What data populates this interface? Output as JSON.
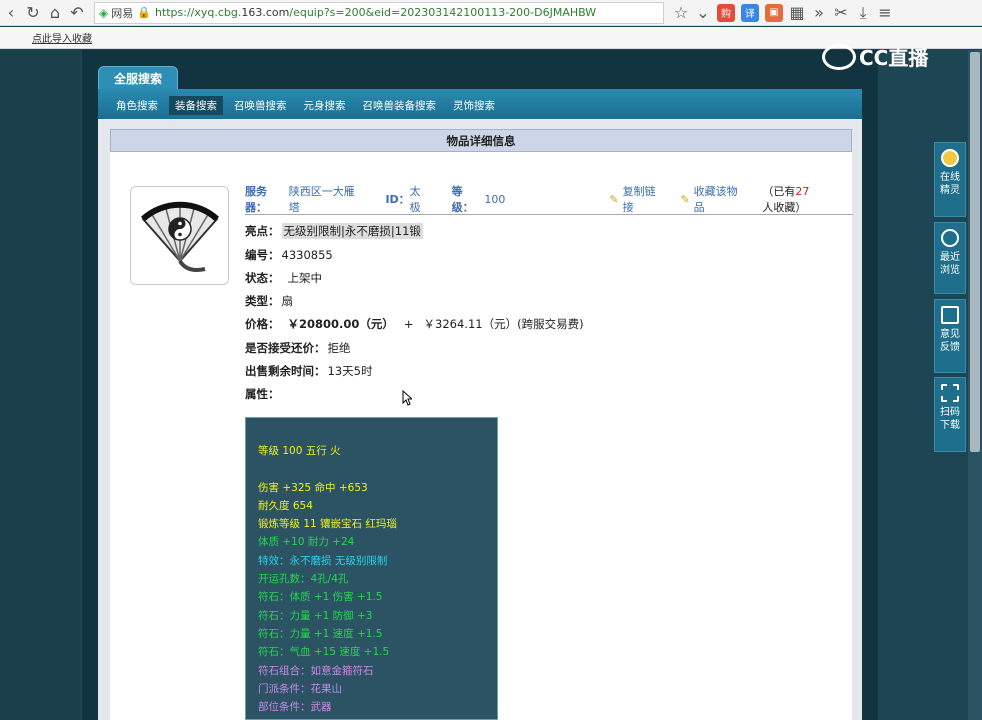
{
  "browser": {
    "url_prefix": "https://xyq.cbg.",
    "url_domain": "163.com",
    "url_path": "/equip?s=200&eid=202303142100113-200-D6JMAHBW",
    "site_label": "网易",
    "bookmark": "点此导入收藏"
  },
  "logo": "CC直播",
  "main_tab": "全服搜索",
  "nav": [
    "角色搜索",
    "装备搜索",
    "召唤兽搜索",
    "元身搜索",
    "召唤兽装备搜索",
    "灵饰搜索"
  ],
  "detail_header": "物品详细信息",
  "seller": {
    "server_label": "服务器：",
    "server_value": "陕西区一大雁塔",
    "id_label": "ID：",
    "id_value": "太极",
    "level_label": "等级：",
    "level_value": "100",
    "copy_link": "复制链接",
    "favorite": "收藏该物品",
    "fav_prefix": "（已有",
    "fav_count": "27",
    "fav_suffix": "人收藏）"
  },
  "fields": {
    "highlight_label": "亮点：",
    "highlight_value": "无级别限制|永不磨损|11锻",
    "id_label": "编号：",
    "id_value": "4330855",
    "status_label": "状态：",
    "status_value": "上架中",
    "type_label": "类型：",
    "type_value": "扇",
    "price_label": "价格：",
    "price_value": "￥20800.00（元）",
    "price_plus": "+",
    "price_fee": "￥3264.11（元）(跨服交易费)",
    "bargain_label": "是否接受还价：",
    "bargain_value": "拒绝",
    "time_label": "出售剩余时间：",
    "time_value": "13天5时",
    "attr_label": "属性："
  },
  "attributes": [
    {
      "text": "等级 100 五行 火",
      "color": "yellow"
    },
    {
      "text": "",
      "color": "yellow"
    },
    {
      "text": "伤害 +325 命中 +653",
      "color": "yellow"
    },
    {
      "text": "耐久度 654",
      "color": "yellow"
    },
    {
      "text": "锻炼等级 11 镶嵌宝石 红玛瑙",
      "color": "yellow"
    },
    {
      "text": "体质 +10 耐力 +24",
      "color": "green"
    },
    {
      "text": "特效：永不磨损 无级别限制",
      "color": "cyan"
    },
    {
      "text": "开运孔数：4孔/4孔",
      "color": "green"
    },
    {
      "text": "符石：体质 +1 伤害 +1.5",
      "color": "green"
    },
    {
      "text": "符石：力量 +1 防御 +3",
      "color": "green"
    },
    {
      "text": "符石：力量 +1 速度 +1.5",
      "color": "green"
    },
    {
      "text": "符石：气血 +15 速度 +1.5",
      "color": "green"
    },
    {
      "text": "符石组合：如意金箍符石",
      "color": "purple"
    },
    {
      "text": "门派条件：花果山",
      "color": "purple"
    },
    {
      "text": "部位条件：武器",
      "color": "purple"
    }
  ],
  "side_panel": [
    {
      "line1": "在线",
      "line2": "精灵"
    },
    {
      "line1": "最近",
      "line2": "浏览"
    },
    {
      "line1": "意见",
      "line2": "反馈"
    },
    {
      "line1": "扫码",
      "line2": "下载"
    }
  ]
}
